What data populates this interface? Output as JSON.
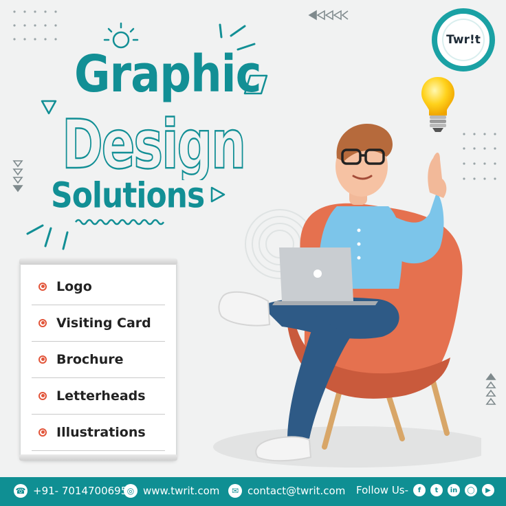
{
  "heading": {
    "line1": "Graphic",
    "line2": "Design",
    "line3": "Solutions"
  },
  "services": [
    {
      "label": "Logo"
    },
    {
      "label": "Visiting Card"
    },
    {
      "label": "Brochure"
    },
    {
      "label": "Letterheads"
    },
    {
      "label": "Illustrations"
    }
  ],
  "brand": {
    "logo_text": "Twr!t"
  },
  "footer": {
    "phone": "+91- 7014700695",
    "website": "www.twrit.com",
    "email": "contact@twrit.com",
    "follow_label": "Follow Us-",
    "social_icons": [
      "facebook-icon",
      "twitter-icon",
      "linkedin-icon",
      "instagram-icon",
      "youtube-icon"
    ]
  },
  "colors": {
    "teal": "#128f95",
    "orange": "#e2553a",
    "background": "#f1f2f2"
  }
}
